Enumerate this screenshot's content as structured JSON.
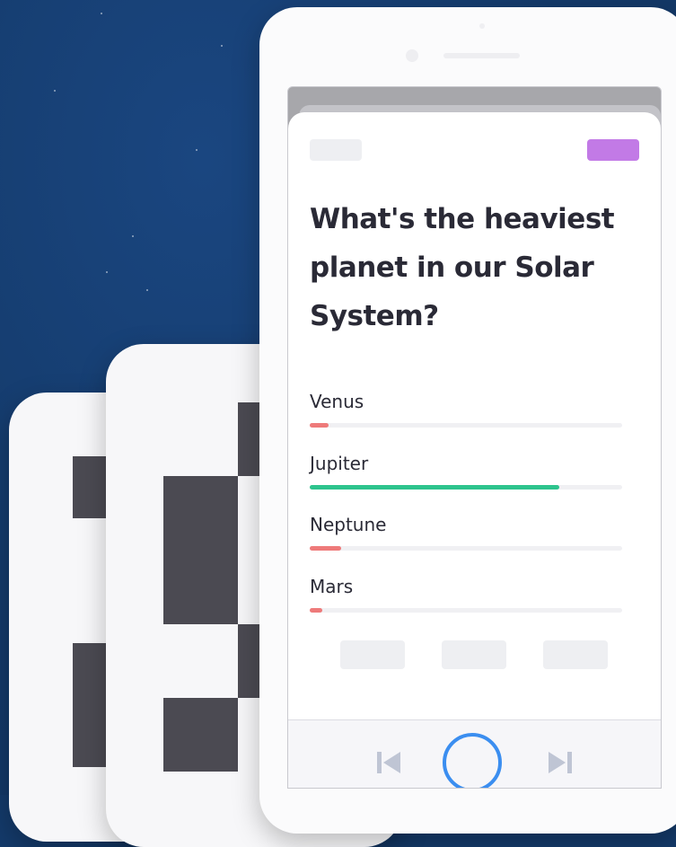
{
  "quiz": {
    "question": "What's the heaviest planet in our Solar System?",
    "answers": [
      {
        "label": "Venus",
        "share": 0.06,
        "color": "#ee7a7a"
      },
      {
        "label": "Jupiter",
        "share": 0.8,
        "color": "#2ec48d"
      },
      {
        "label": "Neptune",
        "share": 0.1,
        "color": "#ee7a7a"
      },
      {
        "label": "Mars",
        "share": 0.04,
        "color": "#ee7a7a"
      }
    ]
  },
  "controls": {
    "prev_icon": "skip-previous-icon",
    "play_icon": "play-circle-icon",
    "next_icon": "skip-next-icon"
  },
  "colors": {
    "background": "#143a6a",
    "accent": "#3b8ef0",
    "tag": "#c27ae6",
    "correct": "#2ec48d",
    "incorrect": "#ee7a7a"
  }
}
